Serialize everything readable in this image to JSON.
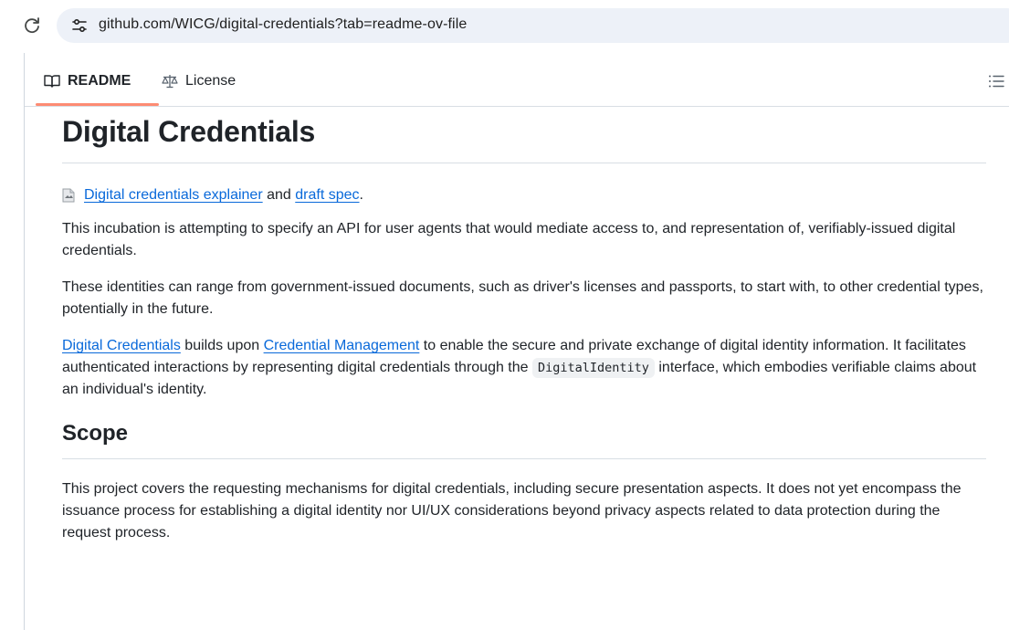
{
  "browser": {
    "url": "github.com/WICG/digital-credentials?tab=readme-ov-file",
    "reload_icon": "reload-icon",
    "site_info_icon": "tune-icon"
  },
  "tabs": [
    {
      "label": "README",
      "icon": "book-icon",
      "selected": true
    },
    {
      "label": "License",
      "icon": "law-icon",
      "selected": false
    }
  ],
  "outline_icon": "list-unordered-icon",
  "readme": {
    "title": "Digital Credentials",
    "explainer": {
      "link1": "Digital credentials explainer",
      "between": " and ",
      "link2": "draft spec",
      "end": "."
    },
    "p1": "This incubation is attempting to specify an API for user agents that would mediate access to, and representation of, verifiably-issued digital credentials.",
    "p2": "These identities can range from government-issued documents, such as driver's licenses and passports, to start with, to other credential types, potentially in the future.",
    "p3": {
      "link1": "Digital Credentials",
      "t1": " builds upon ",
      "link2": "Credential Management",
      "t2": " to enable the secure and private exchange of digital identity information. It facilitates authenticated interactions by representing digital credentials through the ",
      "code": "DigitalIdentity",
      "t3": " interface, which embodies verifiable claims about an individual's identity."
    },
    "scope_heading": "Scope",
    "p4": "This project covers the requesting mechanisms for digital credentials, including secure presentation aspects. It does not yet encompass the issuance process for establishing a digital identity nor UI/UX considerations beyond privacy aspects related to data protection during the request process."
  },
  "colors": {
    "link": "#0969da",
    "tab_underline": "#fd8c73",
    "url_bar": "#edf1f8"
  }
}
